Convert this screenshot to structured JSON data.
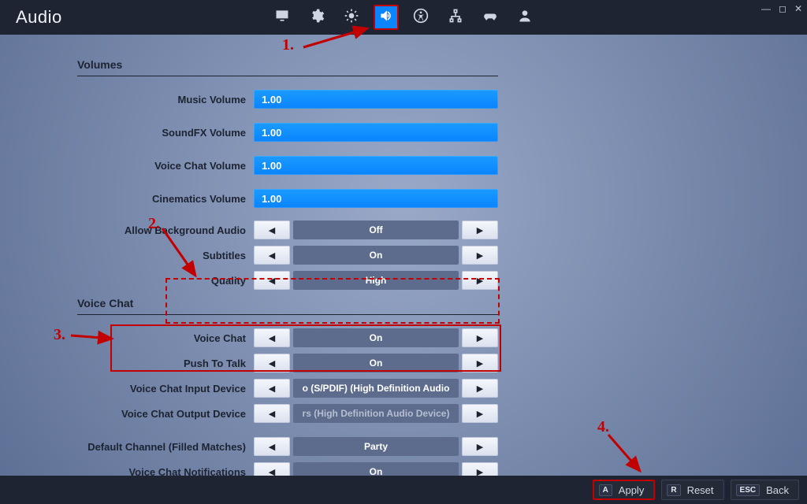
{
  "header": {
    "title": "Audio"
  },
  "tabs": [
    {
      "id": "display",
      "icon": "monitor-icon",
      "active": false
    },
    {
      "id": "game",
      "icon": "gear-icon",
      "active": false
    },
    {
      "id": "brightness",
      "icon": "brightness-icon",
      "active": false
    },
    {
      "id": "audio",
      "icon": "speaker-icon",
      "active": true
    },
    {
      "id": "accessibility",
      "icon": "accessibility-icon",
      "active": false
    },
    {
      "id": "input",
      "icon": "hierarchy-icon",
      "active": false
    },
    {
      "id": "controller",
      "icon": "gamepad-icon",
      "active": false
    },
    {
      "id": "account",
      "icon": "person-icon",
      "active": false
    }
  ],
  "sections": {
    "volumes": {
      "title": "Volumes",
      "music": {
        "label": "Music Volume",
        "value": "1.00"
      },
      "soundfx": {
        "label": "SoundFX Volume",
        "value": "1.00"
      },
      "voice": {
        "label": "Voice Chat Volume",
        "value": "1.00"
      },
      "cinematics": {
        "label": "Cinematics Volume",
        "value": "1.00"
      },
      "bgaudio": {
        "label": "Allow Background Audio",
        "value": "Off"
      },
      "subtitles": {
        "label": "Subtitles",
        "value": "On"
      },
      "quality": {
        "label": "Quality",
        "value": "High"
      }
    },
    "voicechat": {
      "title": "Voice Chat",
      "vc": {
        "label": "Voice Chat",
        "value": "On"
      },
      "ptt": {
        "label": "Push To Talk",
        "value": "On"
      },
      "indev": {
        "label": "Voice Chat Input Device",
        "value": "o (S/PDIF) (High Definition Audio"
      },
      "outdev": {
        "label": "Voice Chat Output Device",
        "value": "rs (High Definition Audio Device)"
      },
      "channel": {
        "label": "Default Channel (Filled Matches)",
        "value": "Party"
      },
      "notif": {
        "label": "Voice Chat Notifications",
        "value": "On"
      }
    }
  },
  "footer": {
    "apply": {
      "key": "A",
      "label": "Apply"
    },
    "reset": {
      "key": "R",
      "label": "Reset"
    },
    "back": {
      "key": "ESC",
      "label": "Back"
    }
  },
  "annotations": {
    "n1": "1.",
    "n2": "2.",
    "n3": "3.",
    "n4": "4."
  }
}
